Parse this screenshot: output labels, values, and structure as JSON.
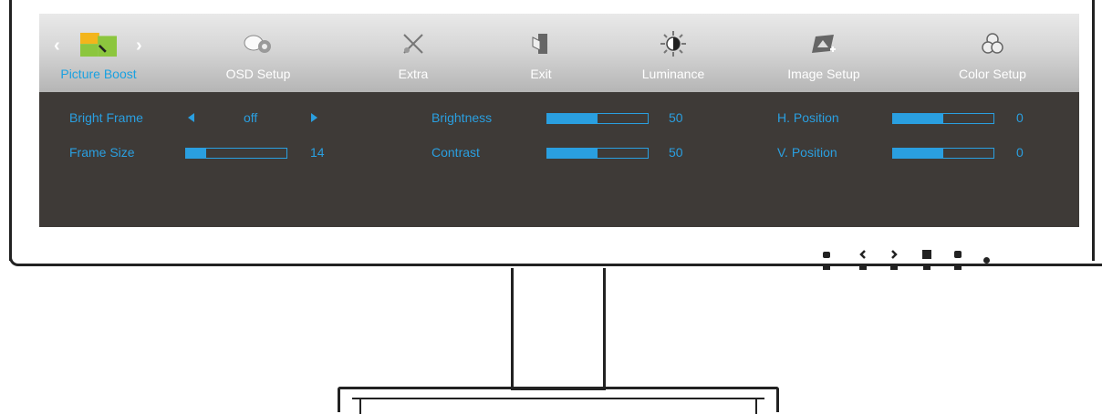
{
  "menu": {
    "items": [
      {
        "label": "Picture Boost",
        "icon": "picture-boost-icon",
        "active": true
      },
      {
        "label": "OSD Setup",
        "icon": "osd-setup-icon"
      },
      {
        "label": "Extra",
        "icon": "extra-icon"
      },
      {
        "label": "Exit",
        "icon": "exit-icon"
      },
      {
        "label": "Luminance",
        "icon": "luminance-icon"
      },
      {
        "label": "Image Setup",
        "icon": "image-setup-icon"
      },
      {
        "label": "Color Setup",
        "icon": "color-setup-icon"
      }
    ],
    "nav_left": "‹",
    "nav_right": "›"
  },
  "settings": {
    "bright_frame": {
      "label": "Bright Frame",
      "value": "off"
    },
    "frame_size": {
      "label": "Frame Size",
      "value": "14",
      "level": 0.2
    },
    "brightness": {
      "label": "Brightness",
      "value": "50",
      "level": 0.5
    },
    "contrast": {
      "label": "Contrast",
      "value": "50",
      "level": 0.5
    },
    "h_position": {
      "label": "H. Position",
      "value": "0",
      "level": 0.5
    },
    "v_position": {
      "label": "V. Position",
      "value": "0",
      "level": 0.5
    }
  },
  "colors": {
    "accent": "#2a9fe0",
    "osd_background": "#3e3a37",
    "menubar_top": "#e9e9e9",
    "menubar_bottom": "#b5b5b5"
  }
}
